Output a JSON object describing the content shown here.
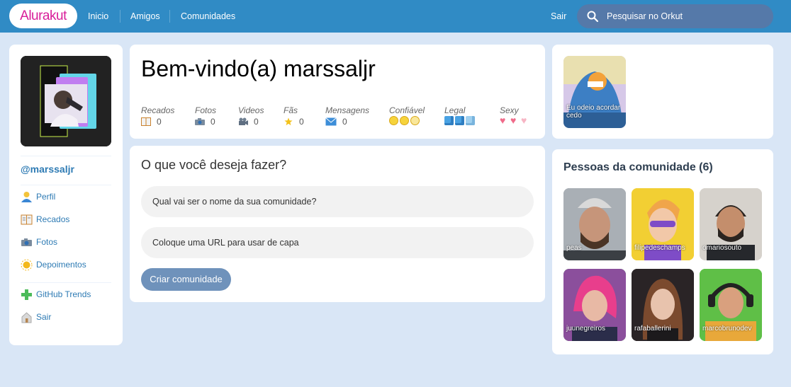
{
  "brand": {
    "logo_text": "Alurakut",
    "accent": "#d81d99",
    "topbar_color": "#308bc5",
    "background": "#d9e6f6"
  },
  "nav": {
    "items": [
      "Inicio",
      "Amigos",
      "Comunidades"
    ],
    "logout": "Sair"
  },
  "search": {
    "placeholder": "Pesquisar no Orkut",
    "icon": "search-icon"
  },
  "profile": {
    "username": "@marssaljr",
    "menu": [
      {
        "label": "Perfil",
        "icon": "user-icon"
      },
      {
        "label": "Recados",
        "icon": "book-icon"
      },
      {
        "label": "Fotos",
        "icon": "camera-icon"
      },
      {
        "label": "Depoimentos",
        "icon": "sun-icon"
      }
    ],
    "menu2": [
      {
        "label": "GitHub Trends",
        "icon": "plus-icon"
      },
      {
        "label": "Sair",
        "icon": "logout-icon"
      }
    ]
  },
  "welcome": {
    "title": "Bem-vindo(a) marssaljr",
    "stats": [
      {
        "label": "Recados",
        "value": "0",
        "icon": "book-icon"
      },
      {
        "label": "Fotos",
        "value": "0",
        "icon": "camera-icon"
      },
      {
        "label": "Videos",
        "value": "0",
        "icon": "video-camera-icon"
      },
      {
        "label": "Fãs",
        "value": "0",
        "icon": "star-icon"
      },
      {
        "label": "Mensagens",
        "value": "0",
        "icon": "envelope-icon"
      }
    ],
    "ratings": [
      {
        "label": "Confiável",
        "icon": "smiley-icon",
        "level": 3
      },
      {
        "label": "Legal",
        "icon": "ice-cube-icon",
        "level": 3
      },
      {
        "label": "Sexy",
        "icon": "heart-icon",
        "level": 3
      }
    ]
  },
  "create_community": {
    "title": "O que você deseja fazer?",
    "name_placeholder": "Qual vai ser o nome da sua comunidade?",
    "url_placeholder": "Coloque uma URL para usar de capa",
    "submit": "Criar comunidade"
  },
  "communities": [
    {
      "name": "Eu odeio acordar cedo"
    }
  ],
  "community_people": {
    "title": "Pessoas da comunidade (6)",
    "people": [
      "peas",
      "filipedeschamps",
      "omariosouto",
      "juunegreiros",
      "rafaballerini",
      "marcobrunodev"
    ]
  }
}
